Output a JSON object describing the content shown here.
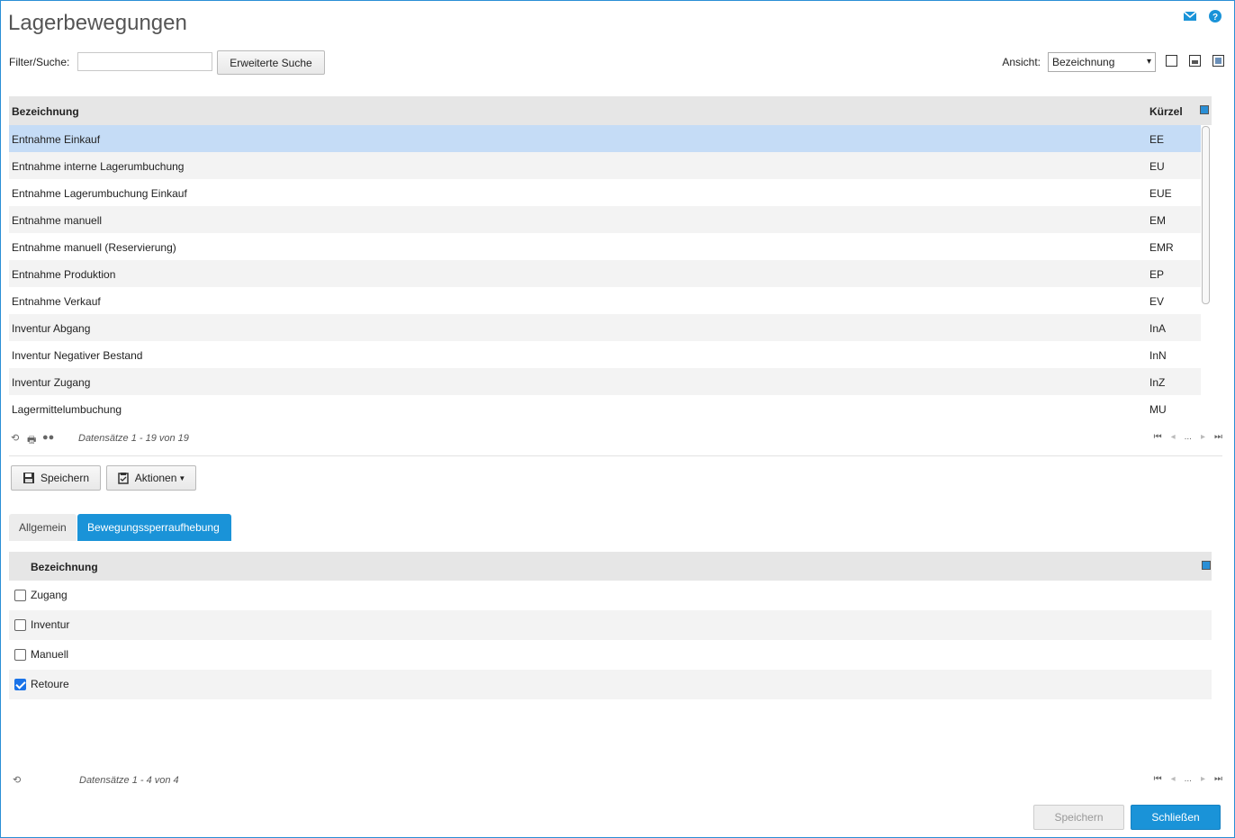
{
  "page": {
    "title": "Lagerbewegungen",
    "mail_icon": "mail-icon",
    "help_icon": "help-icon"
  },
  "filter": {
    "label": "Filter/Suche:",
    "value": "",
    "ext_search_label": "Erweiterte Suche",
    "view_label": "Ansicht:",
    "view_selected": "Bezeichnung"
  },
  "grid1": {
    "headers": {
      "name": "Bezeichnung",
      "code": "Kürzel"
    },
    "rows": [
      {
        "name": "Entnahme Einkauf",
        "code": "EE"
      },
      {
        "name": "Entnahme interne Lagerumbuchung",
        "code": "EU"
      },
      {
        "name": "Entnahme Lagerumbuchung Einkauf",
        "code": "EUE"
      },
      {
        "name": "Entnahme manuell",
        "code": "EM"
      },
      {
        "name": "Entnahme manuell (Reservierung)",
        "code": "EMR"
      },
      {
        "name": "Entnahme Produktion",
        "code": "EP"
      },
      {
        "name": "Entnahme Verkauf",
        "code": "EV"
      },
      {
        "name": "Inventur Abgang",
        "code": "InA"
      },
      {
        "name": "Inventur Negativer Bestand",
        "code": "InN"
      },
      {
        "name": "Inventur Zugang",
        "code": "InZ"
      },
      {
        "name": "Lagermittelumbuchung",
        "code": "MU"
      }
    ],
    "records": "Datensätze 1 - 19 von 19",
    "ellipsis": "..."
  },
  "toolbar": {
    "save_label": "Speichern",
    "actions_label": "Aktionen"
  },
  "tabs": {
    "general": "Allgemein",
    "release": "Bewegungssperraufhebung"
  },
  "grid2": {
    "header": "Bezeichnung",
    "rows": [
      {
        "name": "Zugang",
        "checked": false
      },
      {
        "name": "Inventur",
        "checked": false
      },
      {
        "name": "Manuell",
        "checked": false
      },
      {
        "name": "Retoure",
        "checked": true
      }
    ],
    "records": "Datensätze 1 - 4 von 4",
    "ellipsis": "..."
  },
  "footer": {
    "save_label": "Speichern",
    "close_label": "Schließen"
  }
}
